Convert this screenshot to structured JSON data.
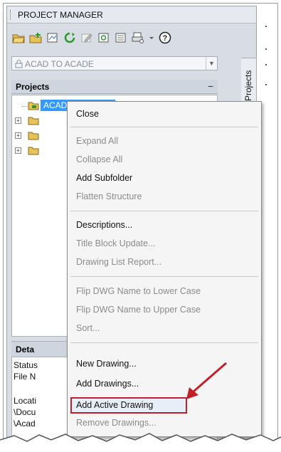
{
  "palette": {
    "title": "PROJECT MANAGER",
    "project_combo": {
      "value": "ACAD TO ACADE"
    },
    "projects_header": "Projects",
    "collapse_glyph": "−",
    "side_tab": "Projects",
    "tree": {
      "selected_label": "ACAD TO ACADE",
      "expand_glyph": "+"
    },
    "details": {
      "header": "Deta",
      "lines": [
        "Status",
        "File N",
        "",
        "Locati",
        "\\Docu",
        "\\Acad"
      ]
    },
    "toolbar_icons": [
      "open-project-icon",
      "new-project-icon",
      "new-drawing-icon",
      "refresh-icon",
      "edit-icon",
      "properties-icon",
      "drawing-list-icon",
      "plot-icon",
      "dropdown-arrow-icon",
      "help-icon"
    ]
  },
  "context_menu": {
    "items": [
      {
        "label": "Close",
        "enabled": true
      },
      {
        "label": "Expand All",
        "enabled": false
      },
      {
        "label": "Collapse All",
        "enabled": false
      },
      {
        "label": "Add Subfolder",
        "enabled": true
      },
      {
        "label": "Flatten Structure",
        "enabled": false
      },
      {
        "label": "Descriptions...",
        "enabled": true
      },
      {
        "label": "Title Block Update...",
        "enabled": false
      },
      {
        "label": "Drawing List Report...",
        "enabled": false
      },
      {
        "label": "Flip DWG Name to Lower Case",
        "enabled": false
      },
      {
        "label": "Flip DWG Name to Upper Case",
        "enabled": false
      },
      {
        "label": "Sort...",
        "enabled": false
      },
      {
        "label": "New Drawing...",
        "enabled": true
      },
      {
        "label": "Add Drawings...",
        "enabled": true
      },
      {
        "label": "Add Active Drawing",
        "enabled": true,
        "highlighted": true
      },
      {
        "label": "Remove Drawings...",
        "enabled": false
      }
    ]
  },
  "colors": {
    "selection": "#3399ff",
    "highlight_border": "#c0202a",
    "arrow": "#c0202a",
    "palette_bg": "#d8dde5"
  }
}
